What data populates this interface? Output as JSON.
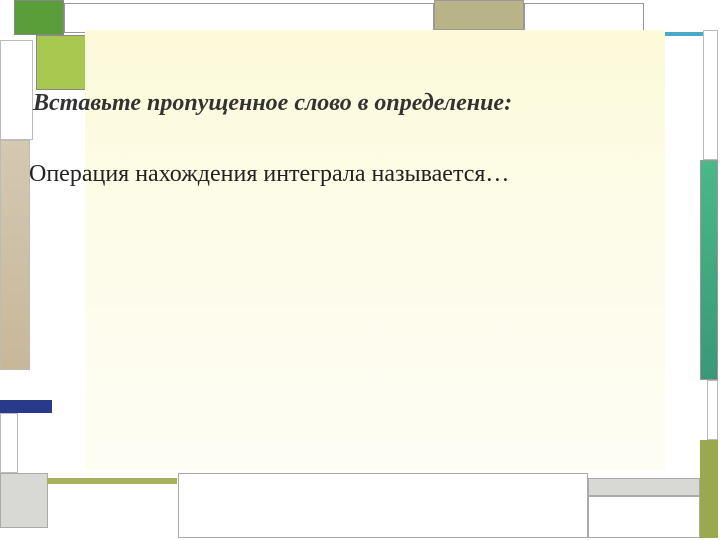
{
  "slide": {
    "heading": "Вставьте пропущенное слово в определение:",
    "body": "Операция нахождения интеграла называется…"
  },
  "colors": {
    "accent_green": "#5a9e3a",
    "lime": "#a8c850",
    "khaki": "#b8b488",
    "tan": "#d4c8b0",
    "navy": "#2a3a8a",
    "teal": "#4ab888",
    "olive": "#9aa850",
    "cyan": "#4aa8c8",
    "panel_bg": "#fcfad8"
  }
}
